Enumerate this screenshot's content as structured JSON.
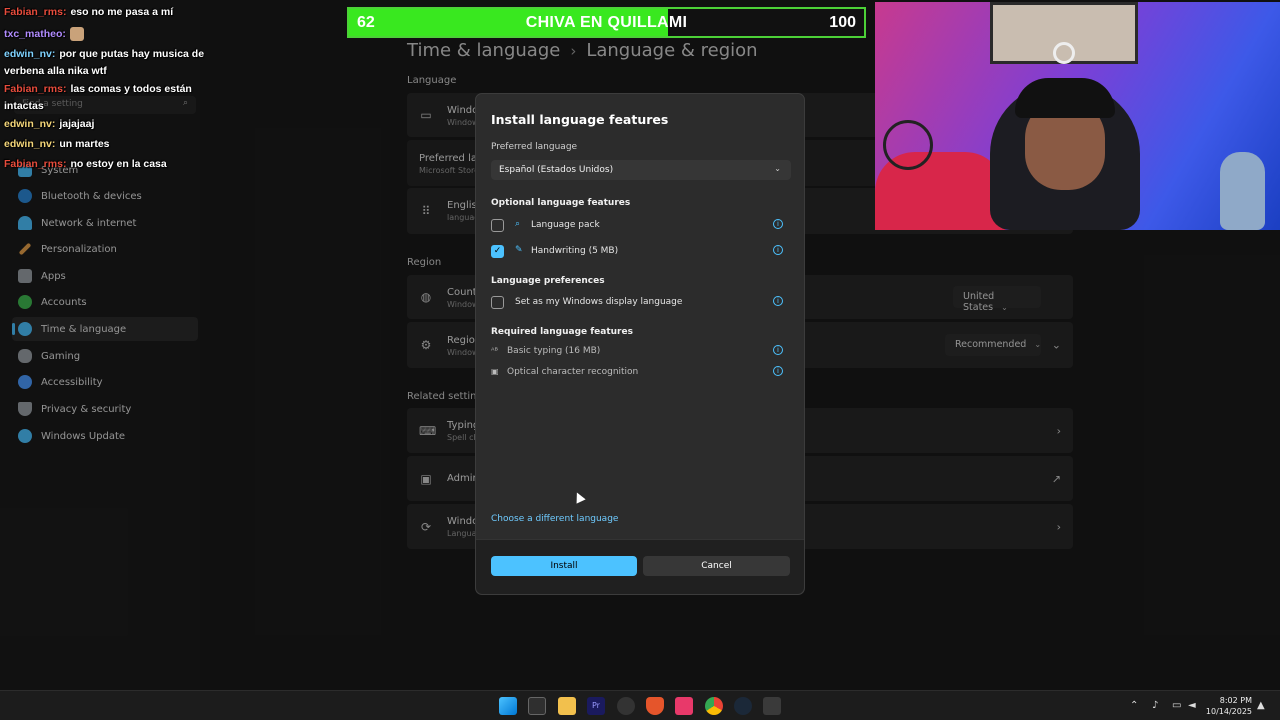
{
  "sidebar": {
    "search_placeholder": "Find a setting",
    "items": [
      {
        "label": "System",
        "icon": "monitor-icon",
        "color": "#4cc2ff"
      },
      {
        "label": "Bluetooth & devices",
        "icon": "bluetooth-icon",
        "color": "#2b88d8"
      },
      {
        "label": "Network & internet",
        "icon": "wifi-icon",
        "color": "#4cc2ff"
      },
      {
        "label": "Personalization",
        "icon": "brush-icon",
        "color": "#e8a24a"
      },
      {
        "label": "Apps",
        "icon": "apps-icon",
        "color": "#9aa0a6"
      },
      {
        "label": "Accounts",
        "icon": "person-icon",
        "color": "#3fb950"
      },
      {
        "label": "Time & language",
        "icon": "globe-clock-icon",
        "color": "#4cc2ff"
      },
      {
        "label": "Gaming",
        "icon": "gamepad-icon",
        "color": "#9aa0a6"
      },
      {
        "label": "Accessibility",
        "icon": "accessibility-icon",
        "color": "#4c9bff"
      },
      {
        "label": "Privacy & security",
        "icon": "shield-icon",
        "color": "#9aa0a6"
      },
      {
        "label": "Windows Update",
        "icon": "update-icon",
        "color": "#4cc2ff"
      }
    ]
  },
  "chat": [
    {
      "user": "Fabian_rms:",
      "text": "eso no me pasa a mí",
      "color": "#e74c3c"
    },
    {
      "user": "txc_matheo:",
      "text": "",
      "color": "#b18cff"
    },
    {
      "user": "edwin_nv:",
      "text": "por que putas hay musica de verbena alla nika wtf",
      "color": "#7fd3ff"
    },
    {
      "user": "Fabian_rms:",
      "text": "las comas y todos están intactas",
      "color": "#e74c3c"
    },
    {
      "user": "edwin_nv:",
      "text": "jajajaaj",
      "color": "#f4d67a"
    },
    {
      "user": "edwin_nv:",
      "text": "un martes",
      "color": "#f4d67a"
    },
    {
      "user": "Fabian_rms:",
      "text": "no estoy en la casa",
      "color": "#e74c3c"
    }
  ],
  "breadcrumb": {
    "parent": "Time & language",
    "sep": "›",
    "current": "Language & region"
  },
  "sections": {
    "language": "Language",
    "region": "Region",
    "related": "Related settings"
  },
  "cards": {
    "windows_display": {
      "t1": "Windows",
      "t2": "Windows"
    },
    "preferred": {
      "t1": "Preferred lang",
      "t2": "Microsoft Store"
    },
    "english": {
      "t1": "English",
      "t2": "language"
    },
    "country": {
      "t1": "Country",
      "t2": "Windows",
      "value": "United States"
    },
    "regional": {
      "t1": "Region",
      "t2": "Windows",
      "value": "Recommended"
    },
    "typing": {
      "t1": "Typing",
      "t2": "Spell ch"
    },
    "admin": {
      "t1": "Admin"
    },
    "windows_backup": {
      "t1": "Windo",
      "t2": "Langua"
    }
  },
  "scorebar": {
    "left": "62",
    "title": "CHIVA EN QUILLAMI",
    "right": "100",
    "fill_fraction": 0.62
  },
  "dialog": {
    "title": "Install language features",
    "preferred_label": "Preferred language",
    "preferred_value": "Español (Estados Unidos)",
    "optional_header": "Optional language features",
    "language_pack": "Language pack",
    "handwriting": "Handwriting (5 MB)",
    "prefs_header": "Language preferences",
    "display_language": "Set as my Windows display language",
    "required_header": "Required language features",
    "basic_typing": "Basic typing (16 MB)",
    "ocr": "Optical character recognition",
    "choose_link": "Choose a different language",
    "install": "Install",
    "cancel": "Cancel"
  },
  "taskbar": {
    "time": "8:02 PM",
    "date": "10/14/2025"
  }
}
